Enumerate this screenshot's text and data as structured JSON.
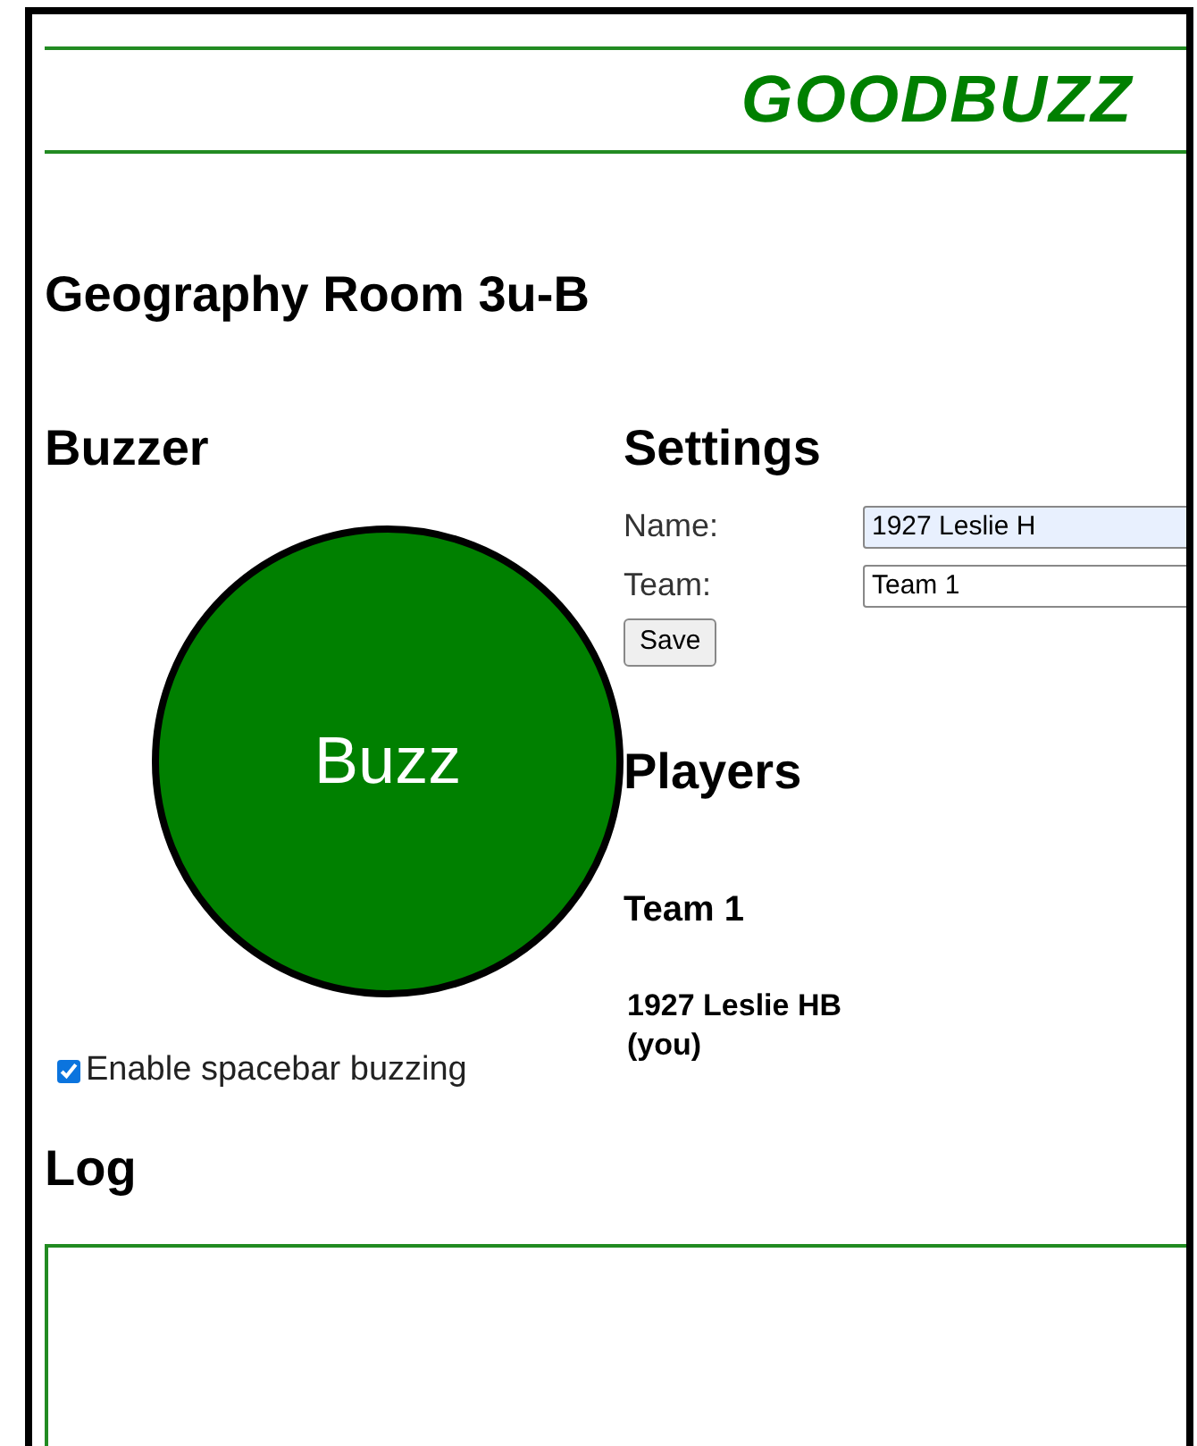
{
  "logo": "GOODBUZZ",
  "room_title": "Geography Room 3u-B",
  "buzzer": {
    "heading": "Buzzer",
    "button": "Buzz",
    "spacebar": {
      "label": "Enable spacebar buzzing",
      "checked": true
    }
  },
  "settings": {
    "heading": "Settings",
    "fields": [
      {
        "label": "Name:",
        "value": "1927 Leslie H",
        "kind": "text"
      },
      {
        "label": "Team:",
        "value": "Team 1",
        "kind": "text"
      }
    ],
    "save": "Save"
  },
  "players": {
    "heading": "Players",
    "teams": [
      {
        "name": "Team 1",
        "players": [
          "1927 Leslie HB (you)"
        ]
      }
    ]
  },
  "log": {
    "heading": "Log"
  }
}
